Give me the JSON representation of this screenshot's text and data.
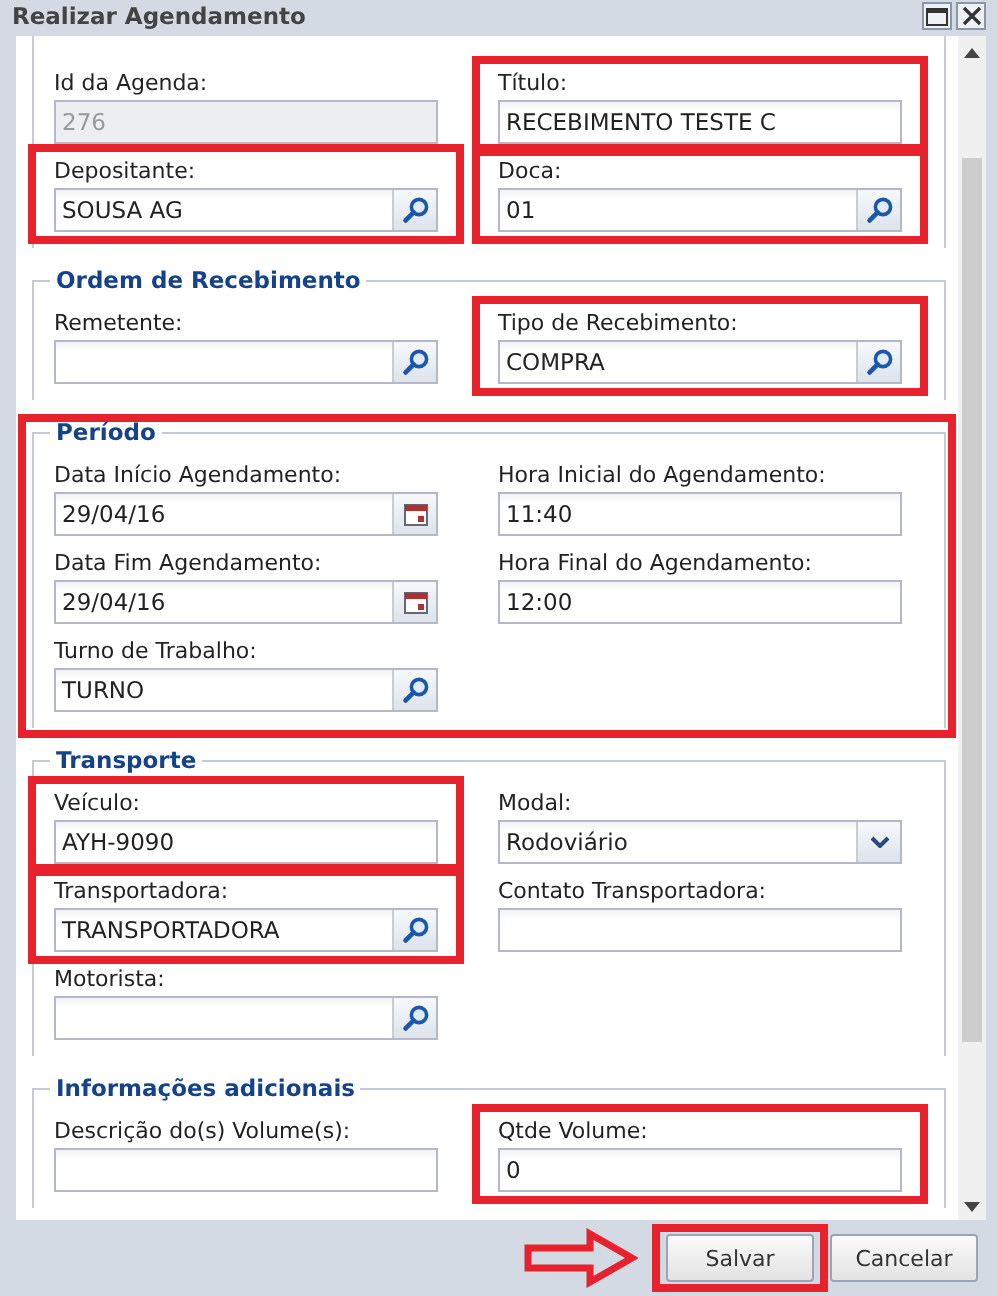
{
  "window": {
    "title": "Realizar Agendamento"
  },
  "sections": [
    {
      "highlighted": false,
      "rows": [
        [
          {
            "label": "Id da Agenda:",
            "value": "276",
            "kind": "text",
            "disabled": true,
            "highlighted": false
          },
          {
            "label": "Título:",
            "value": "RECEBIMENTO TESTE C",
            "kind": "text",
            "disabled": false,
            "highlighted": true
          }
        ],
        [
          {
            "label": "Depositante:",
            "value": "SOUSA AG",
            "kind": "lookup",
            "disabled": false,
            "highlighted": true
          },
          {
            "label": "Doca:",
            "value": "01",
            "kind": "lookup",
            "disabled": false,
            "highlighted": true
          }
        ]
      ]
    },
    {
      "legend": "Ordem de Recebimento",
      "highlighted": false,
      "rows": [
        [
          {
            "label": "Remetente:",
            "kind": "lookup",
            "disabled": false,
            "highlighted": false
          },
          {
            "label": "Tipo de Recebimento:",
            "value": "COMPRA",
            "kind": "lookup",
            "disabled": false,
            "highlighted": true
          }
        ]
      ]
    },
    {
      "legend": "Período",
      "highlighted": true,
      "rows": [
        [
          {
            "label": "Data Início Agendamento:",
            "value": "29/04/16",
            "kind": "date",
            "disabled": false,
            "highlighted": false
          },
          {
            "label": "Hora Inicial do Agendamento:",
            "value": "11:40",
            "kind": "text",
            "disabled": false,
            "highlighted": false
          }
        ],
        [
          {
            "label": "Data Fim Agendamento:",
            "value": "29/04/16",
            "kind": "date",
            "disabled": false,
            "highlighted": false
          },
          {
            "label": "Hora Final do Agendamento:",
            "value": "12:00",
            "kind": "text",
            "disabled": false,
            "highlighted": false
          }
        ],
        [
          {
            "label": "Turno de Trabalho:",
            "value": "TURNO",
            "kind": "lookup",
            "disabled": false,
            "highlighted": false
          }
        ]
      ]
    },
    {
      "legend": "Transporte",
      "highlighted": false,
      "rows": [
        [
          {
            "label": "Veículo:",
            "value": "AYH-9090",
            "kind": "text",
            "disabled": false,
            "highlighted": true
          },
          {
            "label": "Modal:",
            "value": "Rodoviário",
            "kind": "select",
            "disabled": false,
            "highlighted": false
          }
        ],
        [
          {
            "label": "Transportadora:",
            "value": "TRANSPORTADORA",
            "kind": "lookup",
            "disabled": false,
            "highlighted": true
          },
          {
            "label": "Contato Transportadora:",
            "kind": "text",
            "disabled": false,
            "highlighted": false
          }
        ],
        [
          {
            "label": "Motorista:",
            "kind": "lookup",
            "disabled": false,
            "highlighted": false
          }
        ]
      ]
    },
    {
      "legend": "Informações adicionais",
      "highlighted": false,
      "rows": [
        [
          {
            "label": "Descrição do(s) Volume(s):",
            "kind": "text",
            "disabled": false,
            "highlighted": false
          },
          {
            "label": "Qtde Volume:",
            "value": "0",
            "kind": "text",
            "disabled": false,
            "highlighted": true
          }
        ]
      ]
    }
  ],
  "buttons": [
    {
      "label": "Salvar",
      "highlighted": true
    },
    {
      "label": "Cancelar",
      "highlighted": false
    }
  ]
}
